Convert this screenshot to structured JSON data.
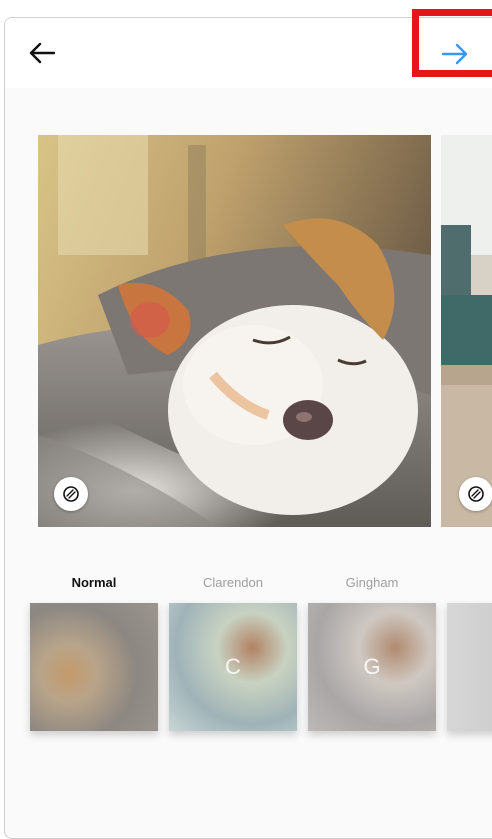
{
  "icons": {
    "back": "arrow-left-icon",
    "next": "arrow-right-icon",
    "edit": "adjust-icon"
  },
  "colors": {
    "accent": "#3897f0",
    "highlight": "#e8141c"
  },
  "filters": [
    {
      "name": "Normal",
      "letter": "",
      "selected": true
    },
    {
      "name": "Clarendon",
      "letter": "C",
      "selected": false
    },
    {
      "name": "Gingham",
      "letter": "G",
      "selected": false
    },
    {
      "name": "",
      "letter": "",
      "selected": false
    }
  ]
}
